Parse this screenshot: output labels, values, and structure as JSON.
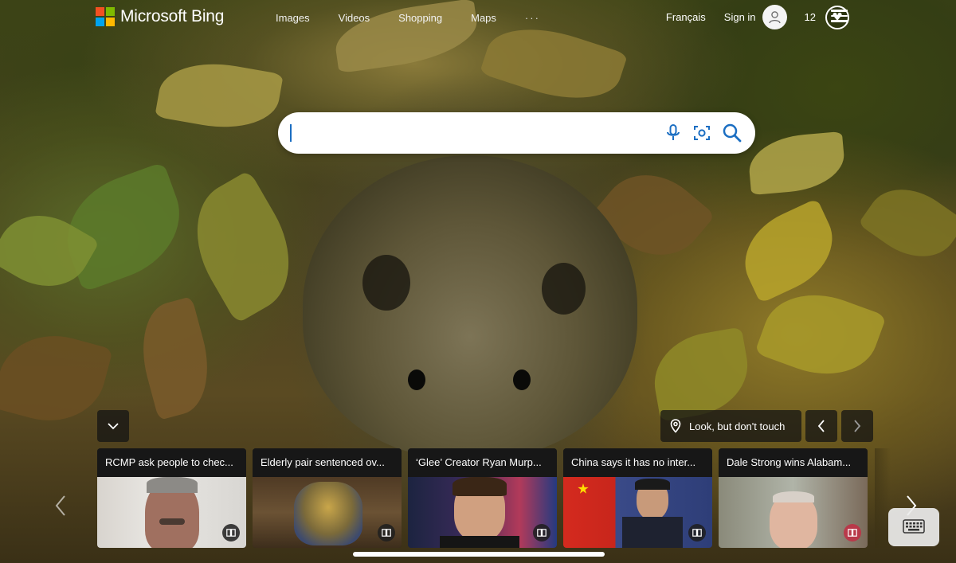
{
  "brand": {
    "name": "Microsoft Bing",
    "logo_colors": [
      "#f25022",
      "#7fba00",
      "#00a4ef",
      "#ffb900"
    ]
  },
  "nav": [
    "Images",
    "Videos",
    "Shopping",
    "Maps",
    "···"
  ],
  "header": {
    "language": "Français",
    "sign_in": "Sign in",
    "points": "12"
  },
  "search": {
    "value": "",
    "placeholder": ""
  },
  "image_info": {
    "title": "Look, but don't touch"
  },
  "news": [
    {
      "title": "RCMP ask people to chec..."
    },
    {
      "title": "Elderly pair sentenced ov..."
    },
    {
      "title": "‘Glee’ Creator Ryan Murp..."
    },
    {
      "title": "China says it has no inter..."
    },
    {
      "title": "Dale Strong wins Alabam..."
    }
  ],
  "colors": {
    "accent": "#1b6ec2",
    "chip_bg": "#141414"
  }
}
